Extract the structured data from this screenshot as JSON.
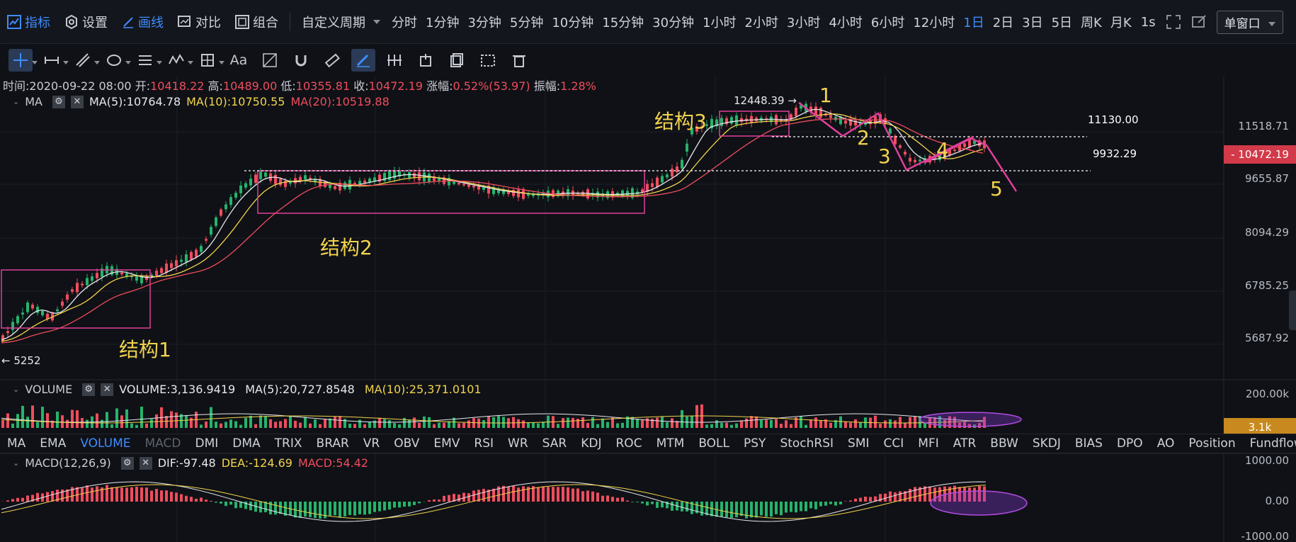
{
  "toolbar": {
    "indicators_label": "指标",
    "settings_label": "设置",
    "draw_label": "画线",
    "compare_label": "对比",
    "combine_label": "组合",
    "custom_period_label": "自定义周期",
    "periods": [
      "分时",
      "1分钟",
      "3分钟",
      "5分钟",
      "10分钟",
      "15分钟",
      "30分钟",
      "1小时",
      "2小时",
      "3小时",
      "4小时",
      "6小时",
      "12小时",
      "1日",
      "2日",
      "3日",
      "5日",
      "周K",
      "月K"
    ],
    "active_period": "1日",
    "refresh_label": "1s",
    "window_mode": "单窗口"
  },
  "drawbar": {
    "text_tool": "Aa"
  },
  "ohlc": {
    "time_label": "时间:",
    "time": "2020-09-22 08:00",
    "open_label": "开:",
    "open": "10418.22",
    "high_label": "高:",
    "high": "10489.00",
    "low_label": "低:",
    "low": "10355.81",
    "close_label": "收:",
    "close": "10472.19",
    "change_label": "涨幅:",
    "change": "0.52%(53.97)",
    "amplitude_label": "振幅:",
    "amplitude": "1.28%"
  },
  "ma_legend": {
    "name": "MA",
    "ma5": "MA(5):10764.78",
    "ma10": "MA(10):10750.55",
    "ma20": "MA(20):10519.88"
  },
  "price_axis": [
    "11518.71",
    "9655.87",
    "8094.29",
    "6785.25",
    "5687.92"
  ],
  "current_price": "10472.19",
  "annotations": {
    "high_marker": "12448.39",
    "low_marker": "5252",
    "level_upper": "11130.00",
    "level_lower": "9932.29",
    "structure1": "结构1",
    "structure2": "结构2",
    "structure3": "结构3",
    "wave1": "1",
    "wave2": "2",
    "wave3": "3",
    "wave4": "4",
    "wave5": "5"
  },
  "volume_legend": {
    "name": "VOLUME",
    "volume": "VOLUME:3,136.9419",
    "ma5": "MA(5):20,727.8548",
    "ma10": "MA(10):25,371.0101"
  },
  "volume_axis": [
    "200.00k"
  ],
  "volume_tag": "3.1k",
  "indicator_tabs": [
    "MA",
    "EMA",
    "VOLUME",
    "MACD",
    "DMI",
    "DMA",
    "TRIX",
    "BRAR",
    "VR",
    "OBV",
    "EMV",
    "RSI",
    "WR",
    "SAR",
    "KDJ",
    "ROC",
    "MTM",
    "BOLL",
    "PSY",
    "StochRSI",
    "SMI",
    "CCI",
    "MFI",
    "ATR",
    "BBW",
    "SKDJ",
    "BIAS",
    "DPO",
    "AO",
    "Position",
    "Fundflow"
  ],
  "active_indicator": "VOLUME",
  "dim_indicator": "MACD",
  "macd_legend": {
    "name": "MACD(12,26,9)",
    "dif": "DIF:-97.48",
    "dea": "DEA:-124.69",
    "macd": "MACD:54.42"
  },
  "macd_axis": [
    "1000.00",
    "0.00",
    "-1000.00"
  ],
  "colors": {
    "up": "#ef4d5d",
    "down": "#26b36b",
    "ma5": "#e6e8ee",
    "ma10": "#f2d34c",
    "ma20": "#ef4d5d",
    "accent": "#3f8cff",
    "annotation": "#f2d34c",
    "box": "#e0409a"
  }
}
